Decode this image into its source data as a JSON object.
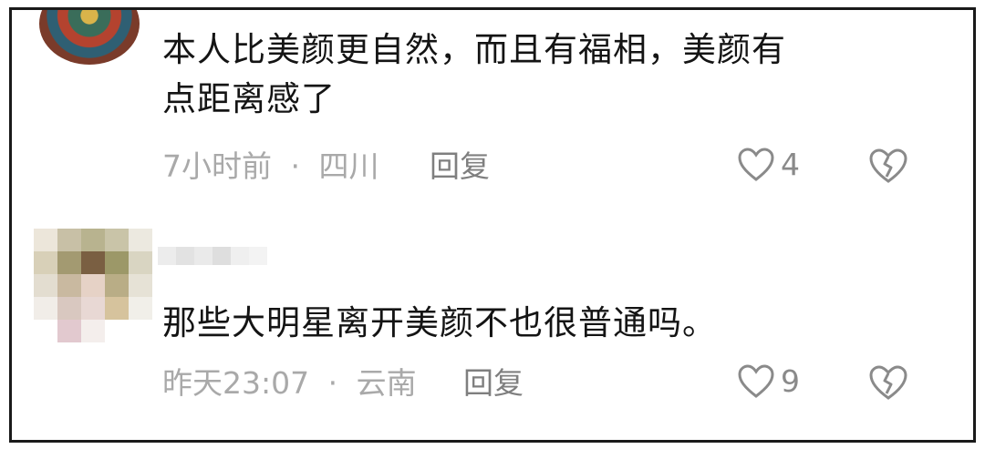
{
  "comments": [
    {
      "text_line1": "本人比美颜更自然，而且有福相，美颜有",
      "text_line2": "点距离感了",
      "time": "7小时前",
      "separator": "·",
      "location": "四川",
      "reply_label": "回复",
      "likes": "4"
    },
    {
      "text_line1": "那些大明星离开美颜不也很普通吗。",
      "time": "昨天23:07",
      "separator": "·",
      "location": "云南",
      "reply_label": "回复",
      "likes": "9"
    }
  ],
  "colors": {
    "text": "#141414",
    "meta": "#a9a9a9",
    "reply": "#7f7f7f",
    "icon": "#8a8a8a"
  },
  "icons": {
    "like": "heart-outline-icon",
    "dislike": "broken-heart-icon"
  }
}
